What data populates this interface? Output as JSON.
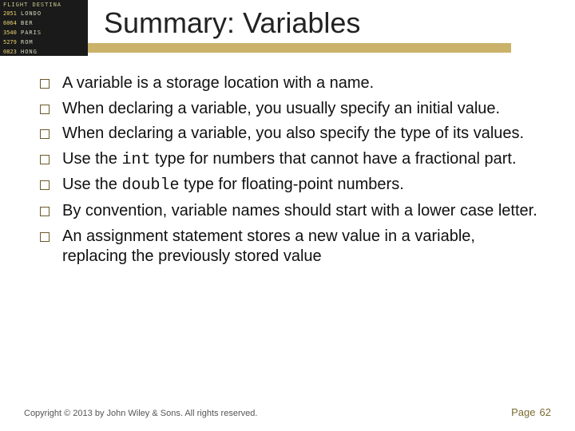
{
  "header": {
    "title": "Summary: Variables",
    "board": {
      "header": "FLIGHT   DESTINA",
      "rows": [
        {
          "num": "2051",
          "dest": "LONDO"
        },
        {
          "num": "6064",
          "dest": "BER"
        },
        {
          "num": "3540",
          "dest": "PARIS"
        },
        {
          "num": "5279",
          "dest": "ROM"
        },
        {
          "num": "0823",
          "dest": "HONG"
        }
      ]
    }
  },
  "bullets": [
    {
      "text": "A variable is a storage location with a name."
    },
    {
      "text": "When declaring a variable, you usually specify an initial value."
    },
    {
      "text": "When declaring a variable, you also specify the type of its values."
    },
    {
      "pre": "Use the ",
      "code": "int",
      "post": " type for numbers that cannot have a fractional part."
    },
    {
      "pre": "Use the ",
      "code": "double",
      "post": " type for floating-point numbers."
    },
    {
      "text": "By convention, variable names should start with a lower case letter."
    },
    {
      "text": "An assignment statement stores a new value in a variable, replacing the previously stored value"
    }
  ],
  "footer": {
    "copyright": "Copyright © 2013 by John Wiley & Sons. All rights reserved.",
    "page_label": "Page",
    "page_number": "62"
  }
}
